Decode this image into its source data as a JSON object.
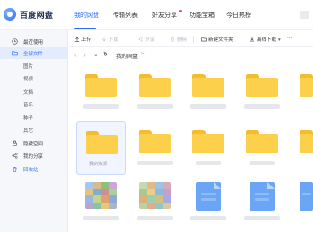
{
  "app": {
    "brand": "百度网盘"
  },
  "nav": {
    "tabs": [
      {
        "label": "我的网盘",
        "active": true
      },
      {
        "label": "传输列表"
      },
      {
        "label": "好友分享",
        "badge": true
      },
      {
        "label": "功能宝箱"
      },
      {
        "label": "今日热榜"
      }
    ]
  },
  "sidebar": {
    "items": [
      {
        "label": "最近使用",
        "icon": "clock-icon"
      },
      {
        "label": "全部文件",
        "icon": "folder-icon",
        "active": true
      },
      {
        "label": "图片",
        "sub": true
      },
      {
        "label": "视频",
        "sub": true
      },
      {
        "label": "文档",
        "sub": true
      },
      {
        "label": "音乐",
        "sub": true
      },
      {
        "label": "种子",
        "sub": true
      },
      {
        "label": "其它",
        "sub": true
      },
      {
        "label": "隐藏空间",
        "icon": "lock-icon"
      },
      {
        "label": "我的分享",
        "icon": "share-icon"
      },
      {
        "label": "回收站",
        "icon": "trash-icon"
      }
    ]
  },
  "toolbar": {
    "upload": "上传",
    "download": "下载",
    "share": "分享",
    "delete": "删除",
    "new_folder": "新建文件夹",
    "offline_download": "离线下载",
    "more": "···"
  },
  "breadcrumb": {
    "current": "我的网盘",
    "separator": ">"
  },
  "files": {
    "selected_label": "我的资源"
  },
  "colors": {
    "accent": "#2f6cf5",
    "folder": "#fcd04a",
    "sidebar_bg": "#f6f7fb"
  }
}
